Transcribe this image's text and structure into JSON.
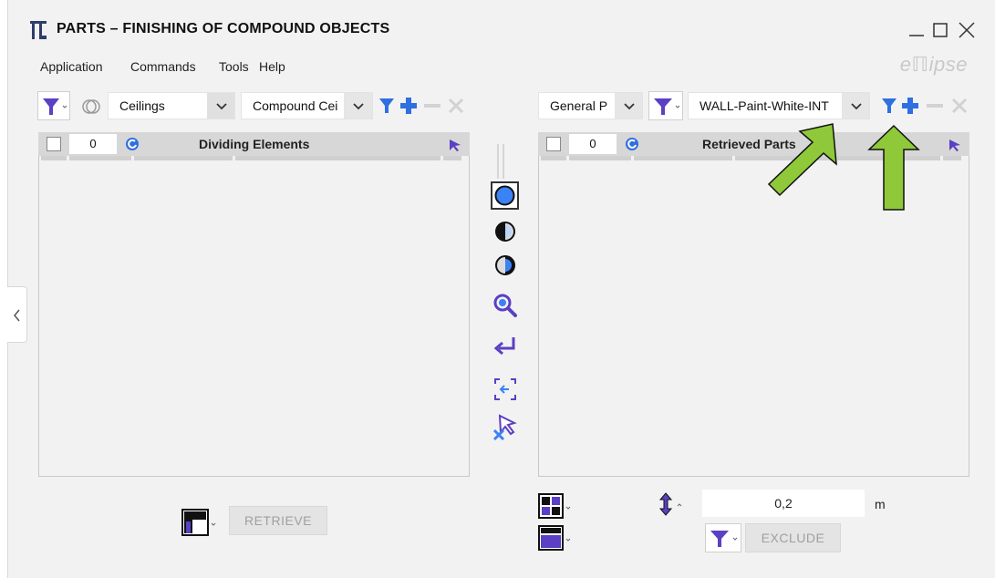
{
  "window": {
    "title": "PARTS – FINISHING OF COMPOUND OBJECTS",
    "brand": "eℿipse"
  },
  "menu": [
    "Application",
    "Commands",
    "Tools",
    "Help"
  ],
  "left": {
    "category": "Ceilings",
    "type": "Compound Cei",
    "header_count": "0",
    "header_label": "Dividing Elements",
    "retrieve_label": "RETRIEVE"
  },
  "right": {
    "category": "General P",
    "filter": "WALL-Paint-White-INT",
    "header_count": "0",
    "header_label": "Retrieved Parts",
    "distance_value": "0,2",
    "distance_unit": "m",
    "exclude_label": "EXCLUDE"
  },
  "colors": {
    "accent_blue": "#3b82f6",
    "accent_purple": "#5b3fc4",
    "arrow_green": "#8fc93a",
    "header_gray": "#d7d7d7"
  },
  "icons": [
    "funnel-icon",
    "no-link-icon",
    "plus-icon",
    "minus-icon",
    "cross-icon",
    "refresh-icon",
    "cursor-icon",
    "circle-full-icon",
    "circle-half-left-icon",
    "circle-half-right-icon",
    "zoom-icon",
    "return-icon",
    "select-back-icon",
    "deselect-cursor-icon",
    "corner-profile-icon",
    "grid-icon",
    "panel-icon",
    "height-arrows-icon"
  ]
}
